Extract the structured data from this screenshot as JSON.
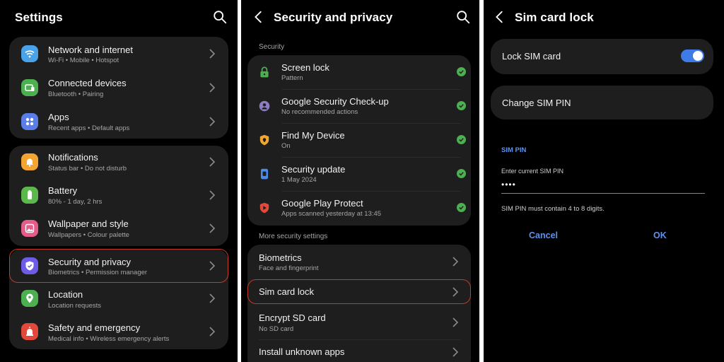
{
  "colors": {
    "accent": "#3e7be6",
    "highlight": "#c33a2a",
    "check": "#4caf50",
    "card": "#1e1e1e"
  },
  "settings": {
    "title": "Settings",
    "search_icon": "search-icon",
    "group1": [
      {
        "title": "Network and internet",
        "sub": "Wi-Fi  •  Mobile  •  Hotspot",
        "icon": "wifi-icon",
        "color": "#4aa3e8"
      },
      {
        "title": "Connected devices",
        "sub": "Bluetooth  •  Pairing",
        "icon": "devices-icon",
        "color": "#4caf50"
      },
      {
        "title": "Apps",
        "sub": "Recent apps  •  Default apps",
        "icon": "apps-icon",
        "color": "#5b7de8"
      }
    ],
    "group2": [
      {
        "title": "Notifications",
        "sub": "Status bar  •  Do not disturb",
        "icon": "bell-icon",
        "color": "#f2a531"
      },
      {
        "title": "Battery",
        "sub": "80% - 1 day, 2 hrs",
        "icon": "battery-icon",
        "color": "#5cb84a"
      },
      {
        "title": "Wallpaper and style",
        "sub": "Wallpapers  •  Colour palette",
        "icon": "wallpaper-icon",
        "color": "#e45c8a"
      }
    ],
    "group3": [
      {
        "title": "Security and privacy",
        "sub": "Biometrics  •  Permission manager",
        "icon": "shield-icon",
        "color": "#6c5ce7"
      },
      {
        "title": "Location",
        "sub": "Location requests",
        "icon": "location-icon",
        "color": "#4caf50"
      },
      {
        "title": "Safety and emergency",
        "sub": "Medical info  •  Wireless emergency alerts",
        "icon": "emergency-icon",
        "color": "#e2493a"
      }
    ]
  },
  "security": {
    "title": "Security and privacy",
    "section1": "Security",
    "items": [
      {
        "title": "Screen lock",
        "sub": "Pattern",
        "icon": "lock-icon",
        "color": "#4caf50"
      },
      {
        "title": "Google Security Check-up",
        "sub": "No recommended actions",
        "icon": "google-account-icon",
        "color": "#8e7cc3"
      },
      {
        "title": "Find My Device",
        "sub": "On",
        "icon": "find-device-icon",
        "color": "#f2a531"
      },
      {
        "title": "Security update",
        "sub": "1 May 2024",
        "icon": "phone-update-icon",
        "color": "#4a8be8"
      },
      {
        "title": "Google Play Protect",
        "sub": "Apps scanned yesterday at 13:45",
        "icon": "play-protect-icon",
        "color": "#e2493a"
      }
    ],
    "section2": "More security settings",
    "more": [
      {
        "title": "Biometrics",
        "sub": "Face and fingerprint"
      },
      {
        "title": "Sim card lock",
        "sub": ""
      },
      {
        "title": "Encrypt SD card",
        "sub": "No SD card"
      },
      {
        "title": "Install unknown apps",
        "sub": ""
      }
    ]
  },
  "simlock": {
    "title": "Sim card lock",
    "lock_label": "Lock SIM card",
    "lock_on": true,
    "change_label": "Change SIM PIN",
    "dialog_title": "SIM PIN",
    "field_label": "Enter current SIM PIN",
    "field_value": "••••",
    "hint": "SIM PIN must contain 4 to 8 digits.",
    "cancel": "Cancel",
    "ok": "OK"
  }
}
